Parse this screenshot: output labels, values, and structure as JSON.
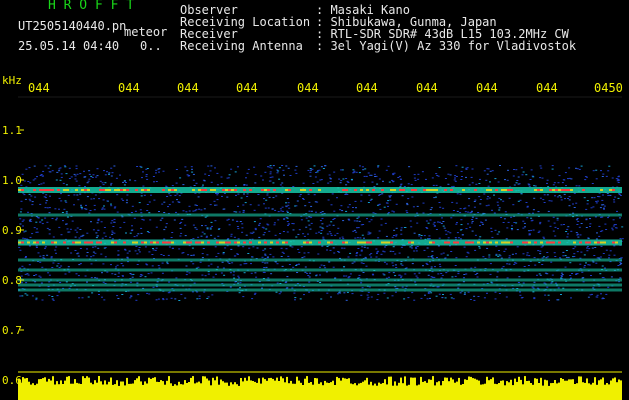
{
  "logo": "H R O F F T",
  "filename": "UT2505140440.pn",
  "meteor": "meteor",
  "datetime": "25.05.14 04:40",
  "counter": "0..",
  "info": [
    {
      "label": "Observer",
      "value": ": Masaki Kano"
    },
    {
      "label": "Receiving Location",
      "value": ": Shibukawa, Gunma, Japan"
    },
    {
      "label": "Receiver",
      "value": ": RTL-SDR SDR# 43dB L15 103.2MHz CW"
    },
    {
      "label": "Receiving Antenna",
      "value": ": 3el Yagi(V) Az 330 for Vladivostok"
    }
  ],
  "y_unit": "kHz",
  "x_ticks": [
    "044",
    "044",
    "044",
    "044",
    "044",
    "044",
    "044",
    "044",
    "044",
    "0450"
  ],
  "y_ticks": [
    "1.1",
    "1.0",
    "0.9",
    "0.8",
    "0.7",
    "0.6"
  ],
  "colors": {
    "header_green": "#19d619",
    "text_white": "#e8e8e8",
    "axis_yellow": "#f0f000",
    "noise_blue": "#1f3cc8"
  },
  "signal_lines_khz": [
    0.98,
    0.93,
    0.875,
    0.84,
    0.82,
    0.8,
    0.79,
    0.78
  ]
}
